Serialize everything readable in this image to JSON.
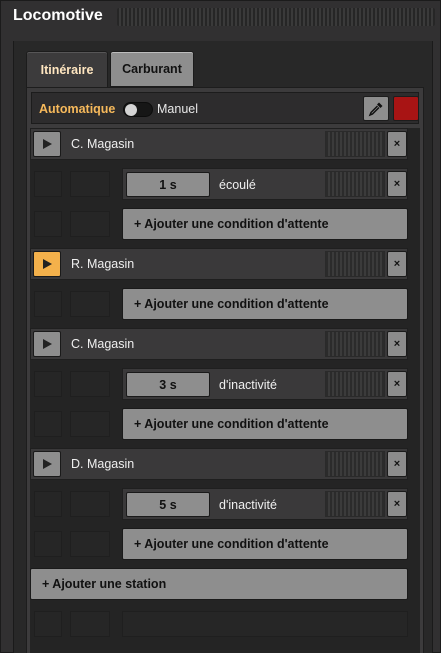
{
  "window": {
    "title": "Locomotive"
  },
  "tabs": [
    {
      "label": "Itinéraire",
      "active": true
    },
    {
      "label": "Carburant",
      "active": false
    }
  ],
  "mode": {
    "automatic_label": "Automatique",
    "manual_label": "Manuel",
    "color": "#a81414"
  },
  "schedule": {
    "stations": [
      {
        "name": "C. Magasin",
        "active": false,
        "conditions": [
          {
            "value": "1 s",
            "label": "écoulé"
          }
        ]
      },
      {
        "name": "R. Magasin",
        "active": true,
        "conditions": []
      },
      {
        "name": "C. Magasin",
        "active": false,
        "conditions": [
          {
            "value": "3 s",
            "label": "d'inactivité"
          }
        ]
      },
      {
        "name": "D. Magasin",
        "active": false,
        "conditions": [
          {
            "value": "5 s",
            "label": "d'inactivité"
          }
        ]
      }
    ],
    "add_condition_label": "+ Ajouter une condition d'attente",
    "add_station_label": "+ Ajouter une station",
    "close_glyph": "×"
  },
  "icons": {
    "play": "play-icon",
    "picker": "eyedropper-icon",
    "close": "close-icon"
  },
  "accent_color": "#f4b14b"
}
